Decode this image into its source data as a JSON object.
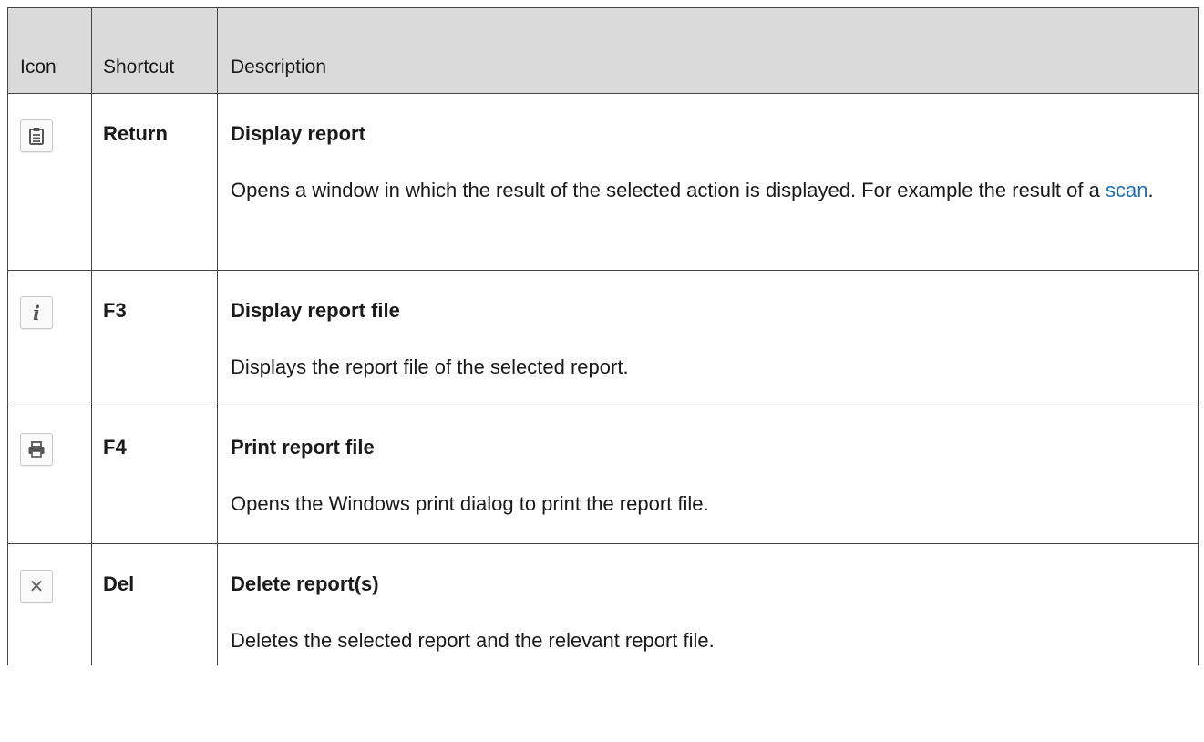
{
  "headers": {
    "icon": "Icon",
    "shortcut": "Shortcut",
    "description": "Description"
  },
  "rows": [
    {
      "icon": "clipboard-report-icon",
      "shortcut": "Return",
      "title": "Display report",
      "text_before": "Opens a window in which the result of the selected action is displayed. For example the result of a ",
      "link": "scan",
      "text_after": "."
    },
    {
      "icon": "info-icon",
      "shortcut": "F3",
      "title": "Display report file",
      "text_before": "Displays the report file of the selected report.",
      "link": "",
      "text_after": ""
    },
    {
      "icon": "printer-icon",
      "shortcut": "F4",
      "title": "Print report file",
      "text_before": "Opens the Windows print dialog to print the report file.",
      "link": "",
      "text_after": ""
    },
    {
      "icon": "delete-x-icon",
      "shortcut": "Del",
      "title": "Delete report(s)",
      "text_before": "Deletes the selected report and the relevant report file.",
      "link": "",
      "text_after": ""
    }
  ],
  "colors": {
    "header_bg": "#dadada",
    "link": "#1d6fb8",
    "border": "#444444"
  }
}
